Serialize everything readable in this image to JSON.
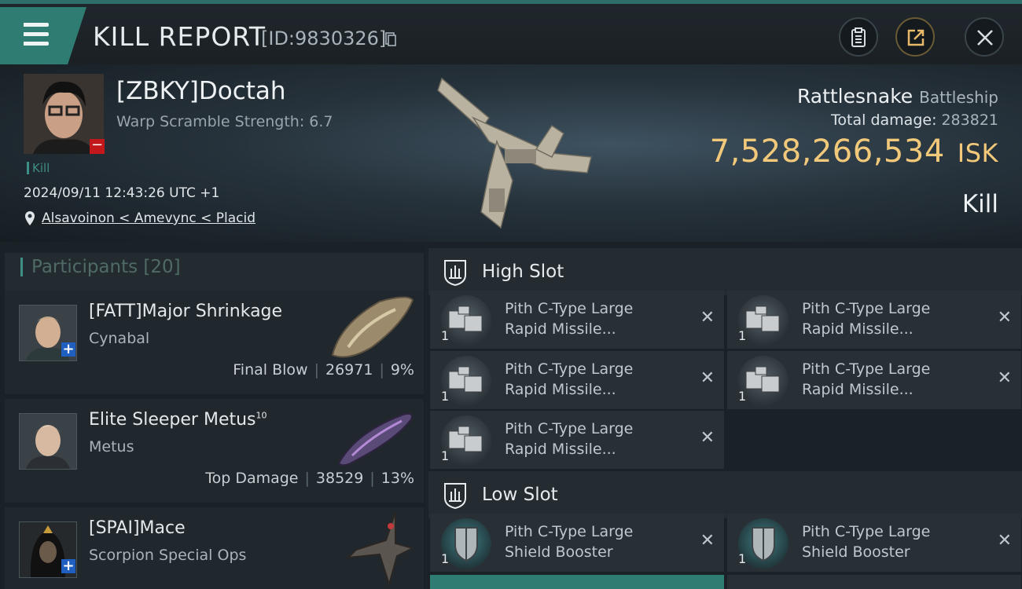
{
  "header": {
    "title": "KILL REPORT",
    "report_id": "[ID:9830326]"
  },
  "victim": {
    "name": "[ZBKY]Doctah",
    "warp_scramble": "Warp Scramble Strength: 6.7",
    "tag": "Kill",
    "datetime": "2024/09/11 12:43:26 UTC +1",
    "location": "Alsavoinon < Amevync < Placid",
    "ship_name": "Rattlesnake",
    "ship_class": "Battleship",
    "total_damage_label": "Total damage:",
    "total_damage": "283821",
    "isk_value": "7,528,266,534",
    "isk_unit": "ISK",
    "result": "Kill"
  },
  "participants": {
    "label": "Participants",
    "count": "[20]",
    "rows": [
      {
        "name": "[FATT]Major Shrinkage",
        "sup": "",
        "ship": "Cynabal",
        "role": "Final Blow",
        "damage": "26971",
        "percent": "9%"
      },
      {
        "name": "Elite Sleeper Metus",
        "sup": "10",
        "ship": "Metus",
        "role": "Top Damage",
        "damage": "38529",
        "percent": "13%"
      },
      {
        "name": "[SPAI]Mace",
        "sup": "",
        "ship": "Scorpion Special Ops",
        "role": "",
        "damage": "",
        "percent": ""
      }
    ]
  },
  "slots": {
    "high": {
      "title": "High Slot",
      "modules": [
        {
          "line1": "Pith C-Type Large",
          "line2": "Rapid Missile...",
          "qty": "1"
        },
        {
          "line1": "Pith C-Type Large",
          "line2": "Rapid Missile...",
          "qty": "1"
        },
        {
          "line1": "Pith C-Type Large",
          "line2": "Rapid Missile...",
          "qty": "1"
        },
        {
          "line1": "Pith C-Type Large",
          "line2": "Rapid Missile...",
          "qty": "1"
        },
        {
          "line1": "Pith C-Type Large",
          "line2": "Rapid Missile...",
          "qty": "1"
        }
      ]
    },
    "low": {
      "title": "Low Slot",
      "modules": [
        {
          "line1": "Pith C-Type Large",
          "line2": "Shield Booster",
          "qty": "1"
        },
        {
          "line1": "Pith C-Type Large",
          "line2": "Shield Booster",
          "qty": "1"
        }
      ]
    },
    "remove_glyph": "✕"
  },
  "colors": {
    "accent": "#3e8f85",
    "isk": "#f2c97a",
    "badge_minus": "#c2181b",
    "badge_plus": "#1e5fbf"
  }
}
